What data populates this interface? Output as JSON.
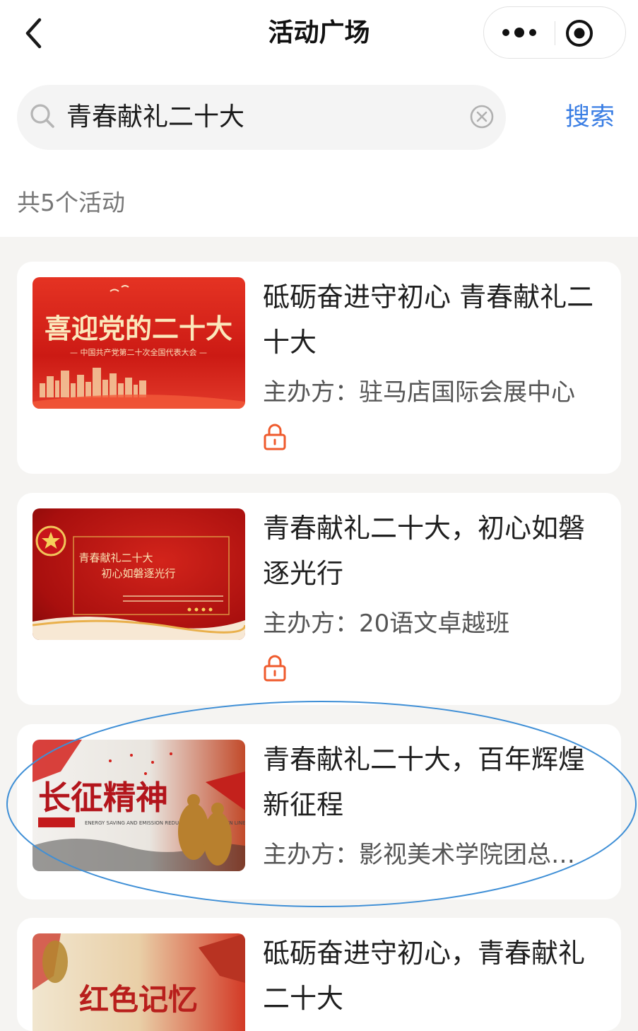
{
  "header": {
    "title": "活动广场"
  },
  "search": {
    "value": "青春献礼二十大",
    "button_label": "搜索"
  },
  "results": {
    "count_label": "共5个活动"
  },
  "activities": [
    {
      "title": "砥砺奋进守初心 青春献礼二十大",
      "organizer": "主办方：驻马店国际会展中心",
      "locked": true,
      "thumb_text": "喜迎党的二十大",
      "thumb_subtext": "— 中国共产党第二十次全国代表大会 —"
    },
    {
      "title": "青春献礼二十大，初心如磐逐光行",
      "organizer": "主办方：20语文卓越班",
      "locked": true,
      "thumb_text_1": "青春献礼二十大",
      "thumb_text_2": "初心如磐逐光行"
    },
    {
      "title": "青春献礼二十大，百年辉煌新征程",
      "organizer": "主办方：影视美术学院团总…",
      "locked": false,
      "thumb_text": "长征精神",
      "thumb_subtext": "ENERGY SAVING AND EMISSION REDUCTION OF THE GREEN LINE"
    },
    {
      "title": "砥砺奋进守初心，青春献礼二十大",
      "thumb_text": "红色记忆"
    }
  ],
  "colors": {
    "accent": "#3a7ee4",
    "lock": "#ef5a2c",
    "annotation": "#3f8fd6"
  }
}
